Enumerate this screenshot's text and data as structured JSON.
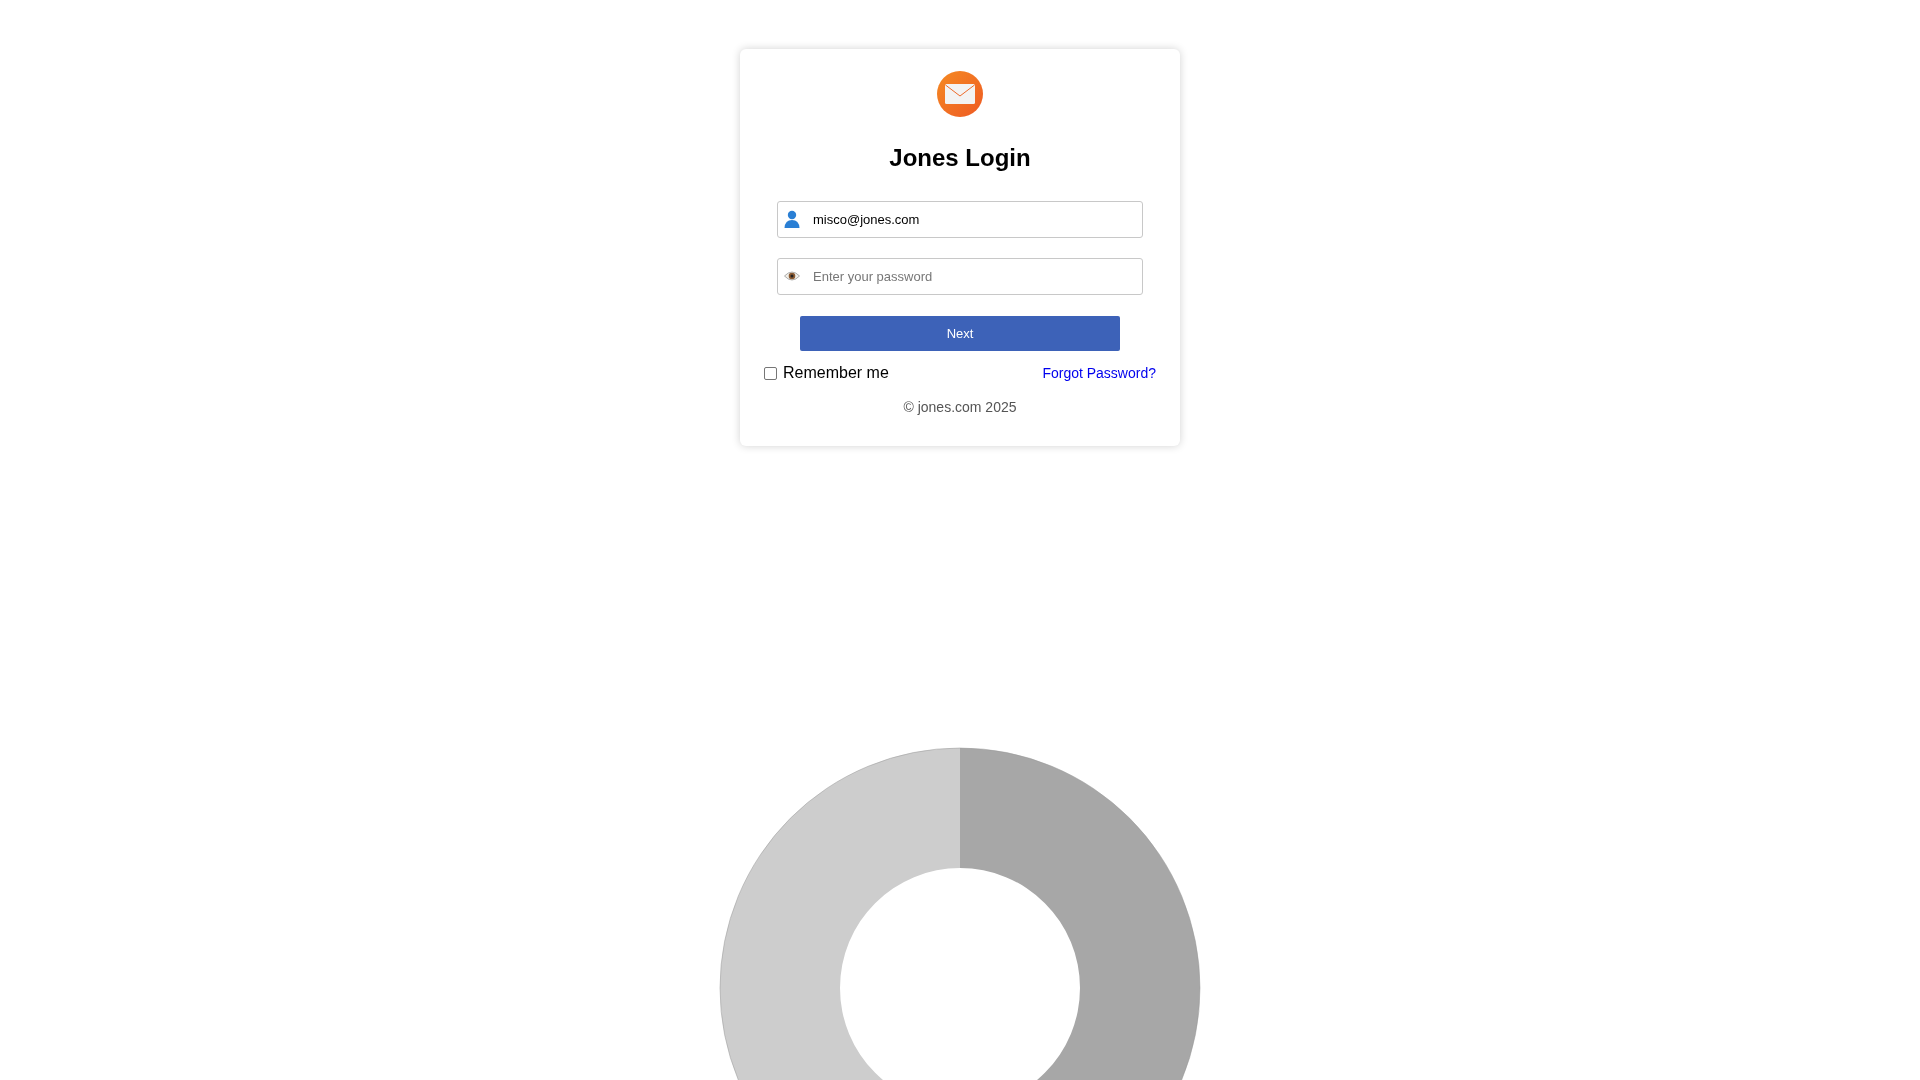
{
  "title": "Jones Login",
  "email_field": {
    "value": "misco@jones.com"
  },
  "password_field": {
    "placeholder": "Enter your password"
  },
  "next_button": {
    "label": "Next"
  },
  "remember_me": {
    "label": "Remember me",
    "checked": false
  },
  "forgot_password_link": "Forgot Password?",
  "footer": "© jones.com 2025"
}
